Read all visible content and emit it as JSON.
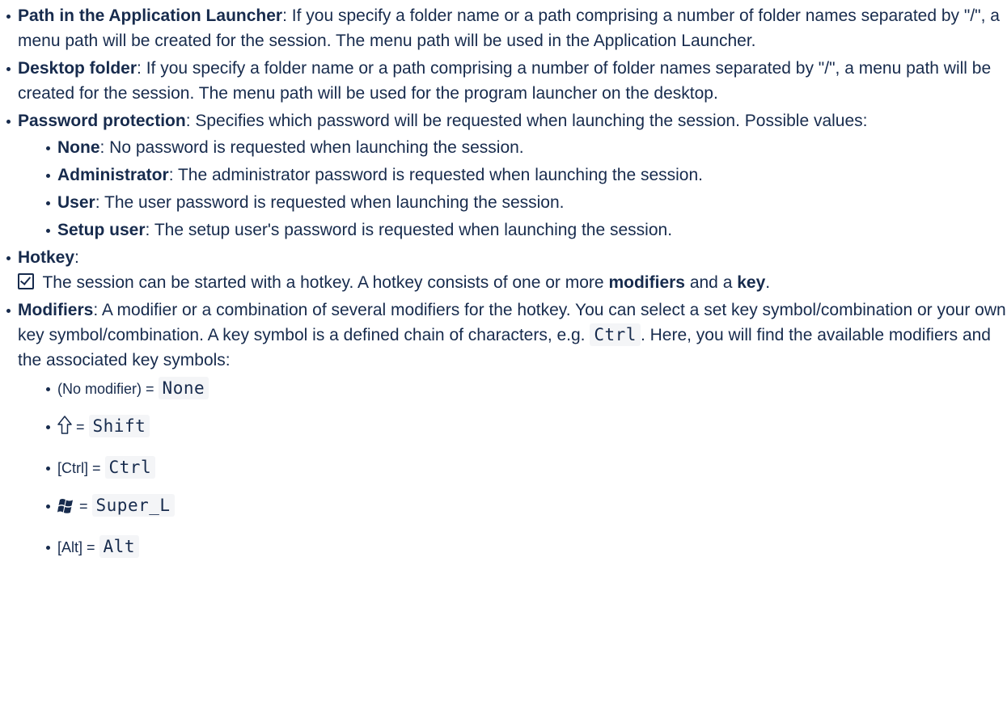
{
  "items": {
    "path": {
      "term": "Path in the Application Launcher",
      "desc": ": If you specify a folder name or a path comprising a number of folder names separated by \"/\", a menu path will be created for the session. The menu path will be used in the Application Launcher."
    },
    "desktop": {
      "term": "Desktop folder",
      "desc": ": If you specify a folder name or a path comprising a number of folder names separated by \"/\", a menu path will be created for the session. The menu path will be used for the program launcher on the desktop."
    },
    "password": {
      "term": "Password protection",
      "desc": ": Specifies which password will be requested when launching the session. Possible values:",
      "values": [
        {
          "term": "None",
          "desc": ": No password is requested when launching the session."
        },
        {
          "term": "Administrator",
          "desc": ": The administrator password is requested when launching the session."
        },
        {
          "term": "User",
          "desc": ": The user password is requested when launching the session."
        },
        {
          "term": "Setup user",
          "desc": ": The setup user's password is requested when launching the session."
        }
      ]
    },
    "hotkey": {
      "term": "Hotkey",
      "colon": ":",
      "text_before": " The session can be started with a hotkey. A hotkey consists of one or more ",
      "modifiers_word": "modifiers",
      "text_middle": " and a ",
      "key_word": "key",
      "text_end": "."
    },
    "modifiers": {
      "term": "Modifiers",
      "desc_before": ": A modifier or a combination of several modifiers for the hotkey. You can select a set key symbol/combination or your own key symbol/combination. A key symbol is a defined chain of characters, e.g. ",
      "example_code": "Ctrl",
      "desc_after": ". Here, you will find the available modifiers and the associated key symbols:",
      "list": [
        {
          "label": "(No modifier) = ",
          "code": "None",
          "icon": null
        },
        {
          "label": " = ",
          "code": "Shift",
          "icon": "shift-arrow-icon"
        },
        {
          "label": "[Ctrl] = ",
          "code": "Ctrl",
          "icon": null
        },
        {
          "label": " = ",
          "code": "Super_L",
          "icon": "windows-logo-icon"
        },
        {
          "label": "[Alt] = ",
          "code": "Alt",
          "icon": null
        }
      ]
    }
  }
}
